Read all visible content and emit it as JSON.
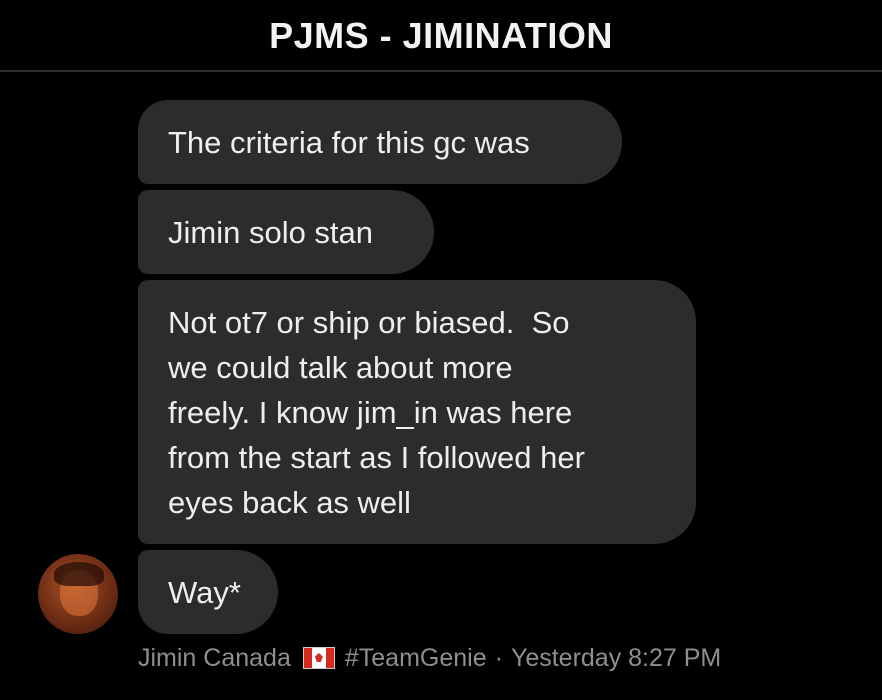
{
  "header": {
    "title": "PJMS - JIMINATION"
  },
  "messages": [
    {
      "text": "The criteria for this gc was"
    },
    {
      "text": "Jimin solo stan"
    },
    {
      "text": "Not ot7 or ship or biased.  So\nwe could talk about more\nfreely. I know jim_in was here\nfrom the start as I followed her\neyes back as well"
    },
    {
      "text": "Way*"
    }
  ],
  "footer": {
    "sender_name": "Jimin Canada",
    "flag_icon": "canada-flag-icon",
    "hashtag": "#TeamGenie",
    "separator": "·",
    "timestamp": "Yesterday 8:27 PM"
  },
  "colors": {
    "background": "#000000",
    "bubble": "#2c2c2e",
    "meta_text": "#8e8e93"
  }
}
